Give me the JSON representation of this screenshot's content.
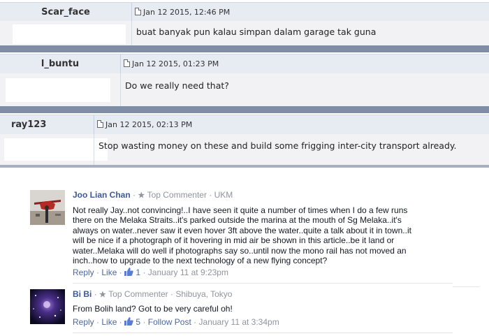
{
  "posts": [
    {
      "author": "Scar_face",
      "date": "Jan 12 2015, 12:46 PM",
      "text": "buat banyak pun kalau simpan dalam garage tak guna"
    },
    {
      "author": "l_buntu",
      "date": "Jan 12 2015, 01:23 PM",
      "text": "Do we really need that?"
    },
    {
      "author": "ray123",
      "date": "Jan 12 2015, 02:13 PM",
      "text": "Stop wasting money on these and build some frigging inter-city transport already."
    }
  ],
  "comments": [
    {
      "name": "Joo Lian Chan",
      "badge": "Top Commenter",
      "location": "UKM",
      "lines": [
        "Not really Jay..not convincing!..I have seen it quite a number of times when I do a few runs",
        "there on the Melaka Straits..it's parked outside the marina at the mouth of Sg Melaka..it's",
        "always on water..never saw it even hover 3ft above the water..quite a talk about it in town..it",
        "will be nice if a photograph of it hovering in mid air be shown in this article..be it land or",
        "water..Melaka will do well if photographs say so..until now the mono rail has not moved an",
        "inch..how to upgrade to the next technology of a new flying concept?"
      ],
      "reply": "Reply",
      "like": "Like",
      "likes": "1",
      "time": "January 11 at 9:23pm"
    },
    {
      "name": "Bi Bi",
      "badge": "Top Commenter",
      "location": "Shibuya, Tokyo",
      "lines": [
        "From Bolih land? Got to be very careful oh!"
      ],
      "reply": "Reply",
      "like": "Like",
      "likes": "5",
      "follow": "Follow Post",
      "time": "January 11 at 3:34pm"
    }
  ]
}
